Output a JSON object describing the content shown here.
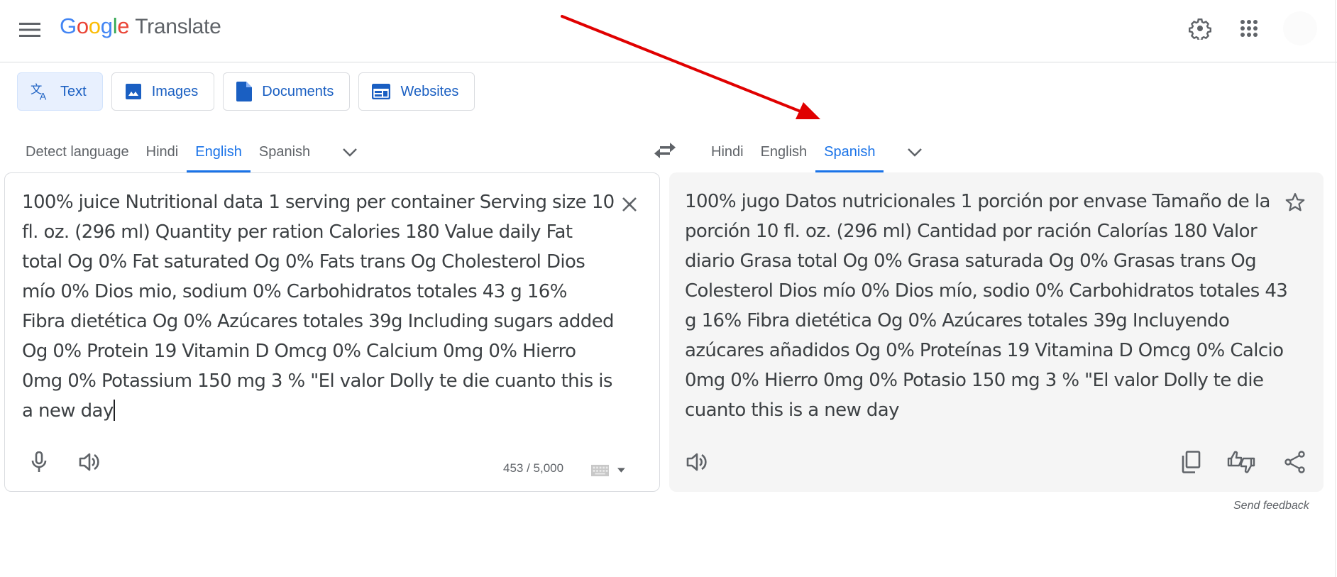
{
  "header": {
    "logo": {
      "letters": [
        "G",
        "o",
        "o",
        "g",
        "l",
        "e"
      ],
      "product": "Translate"
    },
    "icons": [
      "menu-icon",
      "settings-icon",
      "apps-grid-icon",
      "avatar"
    ]
  },
  "modes": [
    {
      "label": "Text",
      "icon": "translate-icon",
      "active": true
    },
    {
      "label": "Images",
      "icon": "image-icon",
      "active": false
    },
    {
      "label": "Documents",
      "icon": "document-icon",
      "active": false
    },
    {
      "label": "Websites",
      "icon": "website-icon",
      "active": false
    }
  ],
  "source_langs": [
    {
      "label": "Detect language",
      "active": false
    },
    {
      "label": "Hindi",
      "active": false
    },
    {
      "label": "English",
      "active": true
    },
    {
      "label": "Spanish",
      "active": false
    }
  ],
  "target_langs": [
    {
      "label": "Hindi",
      "active": false
    },
    {
      "label": "English",
      "active": false
    },
    {
      "label": "Spanish",
      "active": true
    }
  ],
  "source": {
    "text": "100% juice Nutritional data 1 serving per container Serving size 10 fl. oz. (296 ml) Quantity per ration Calories 180 Value daily Fat total Og 0% Fat saturated Og 0% Fats trans Og Cholesterol Dios mío 0% Dios mio, sodium 0% Carbohidratos totales 43 g 16% Fibra dietética Og 0% Azúcares totales 39g Including sugars added Og 0% Protein 19 Vitamin D Omcg 0% Calcium 0mg 0% Hierro 0mg 0% Potassium 150 mg 3 % \"El valor Dolly te die cuanto this is a new day",
    "char_count": "453 / 5,000"
  },
  "target": {
    "text": "100% jugo Datos nutricionales 1 porción por envase Tamaño de la porción 10 fl. oz. (296 ml) Cantidad por ración Calorías 180 Valor diario Grasa total Og 0% Grasa saturada Og 0% Grasas trans Og Colesterol Dios mío 0% Dios mío, sodio 0% Carbohidratos totales 43 g 16% Fibra dietética Og 0% Azúcares totales 39g Incluyendo azúcares añadidos Og 0% Proteínas 19 Vitamina D Omcg 0% Calcio 0mg 0% Hierro 0mg 0% Potasio 150 mg 3 % \"El valor Dolly te die cuanto this is a new day"
  },
  "footer": {
    "feedback": "Send feedback"
  },
  "colors": {
    "accent": "#1a73e8",
    "annotation_arrow": "#e00000",
    "target_panel_bg": "#f5f5f5"
  }
}
